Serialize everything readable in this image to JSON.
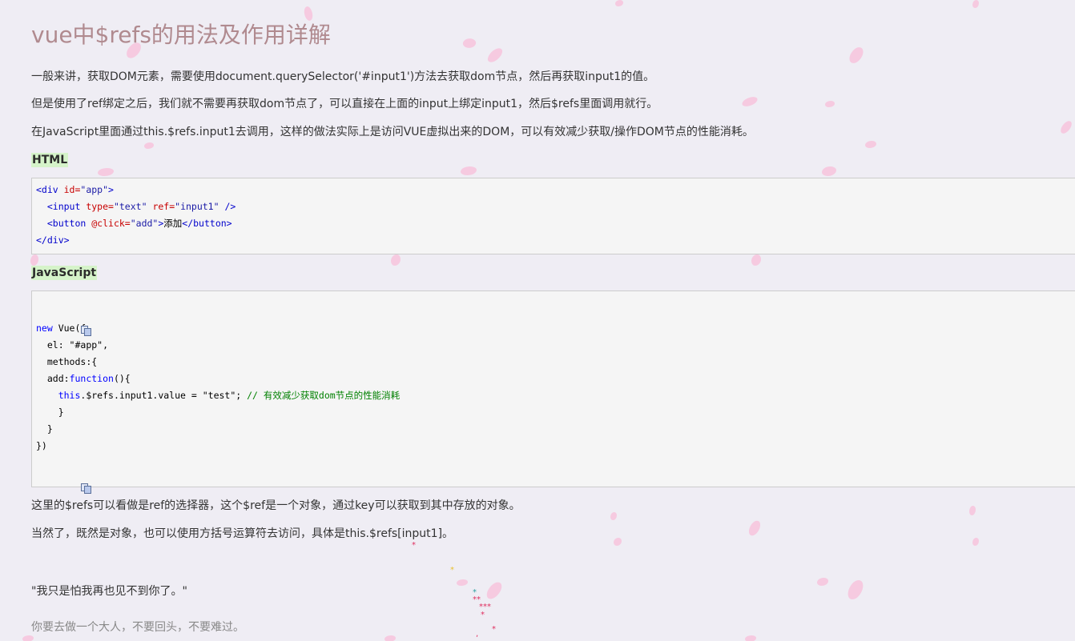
{
  "article": {
    "title": "vue中$refs的用法及作用详解",
    "para1": "一般来讲，获取DOM元素，需要使用document.querySelector('#input1')方法去获取dom节点，然后再获取input1的值。",
    "para2": "但是使用了ref绑定之后，我们就不需要再获取dom节点了，可以直接在上面的input上绑定input1，然后$refs里面调用就行。",
    "para3": "在JavaScript里面通过this.$refs.input1去调用，这样的做法实际上是访问VUE虚拟出来的DOM，可以有效减少获取/操作DOM节点的性能消耗。",
    "html_label": "HTML",
    "html_code": {
      "l1_open": "<div ",
      "l1_attr": "id=",
      "l1_str": "\"app\"",
      "l1_close": ">",
      "l2_open": "<input ",
      "l2_attr1": "type=",
      "l2_str1": "\"text\"",
      "l2_attr2": "ref=",
      "l2_str2": "\"input1\"",
      "l2_close": " />",
      "l3_open": "<button ",
      "l3_attr": "@click=",
      "l3_str": "\"add\"",
      "l3_gt": ">",
      "l3_text": "添加",
      "l3_close": "</button>",
      "l4": "</div>"
    },
    "js_label": "JavaScript",
    "js_code": {
      "l1_kw": "new",
      "l1_rest": " Vue({",
      "l2": "el: \"#app\",",
      "l3": "methods:{",
      "l4_name": "add:",
      "l4_kw": "function",
      "l4_rest": "(){",
      "l5_kw": "this",
      "l5_rest": ".$refs.input1.value = \"test\"; ",
      "l5_comment": "// 有效减少获取dom节点的性能消耗",
      "l6": "}",
      "l7": "}",
      "l8": "})"
    },
    "para4": "这里的$refs可以看做是ref的选择器，这个$ref是一个对象，通过key可以获取到其中存放的对象。",
    "para5": "当然了，既然是对象，也可以使用方括号运算符去访问，具体是this.$refs[input1]。"
  },
  "quote": "\"我只是怕我再也见不到你了。\"",
  "subquote": "你要去做一个大人，不要回头，不要难过。",
  "icons": {
    "copy": "copy-icon"
  }
}
